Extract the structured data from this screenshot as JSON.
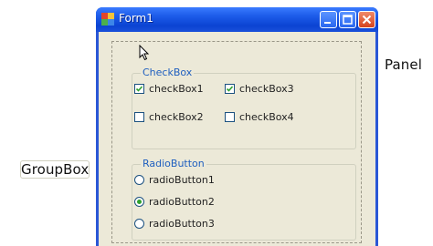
{
  "window": {
    "title": "Form1",
    "controls": {
      "minimize": "minimize",
      "maximize": "maximize",
      "close": "close"
    }
  },
  "annotations": {
    "panel": "Panel",
    "groupbox": "GroupBox"
  },
  "checkbox_group": {
    "title": "CheckBox",
    "items": [
      {
        "label": "checkBox1",
        "checked": true
      },
      {
        "label": "checkBox3",
        "checked": true
      },
      {
        "label": "checkBox2",
        "checked": false
      },
      {
        "label": "checkBox4",
        "checked": false
      }
    ]
  },
  "radio_group": {
    "title": "RadioButton",
    "items": [
      {
        "label": "radioButton1",
        "selected": false
      },
      {
        "label": "radioButton2",
        "selected": true
      },
      {
        "label": "radioButton3",
        "selected": false
      }
    ]
  },
  "colors": {
    "titlebar": "#0b43d3",
    "client_bg": "#ece9d8",
    "group_title": "#1f5fbf",
    "check_mark": "#2ea12e"
  },
  "icons": [
    "form-app-icon",
    "minimize-icon",
    "maximize-icon",
    "close-icon",
    "mouse-cursor-icon"
  ]
}
